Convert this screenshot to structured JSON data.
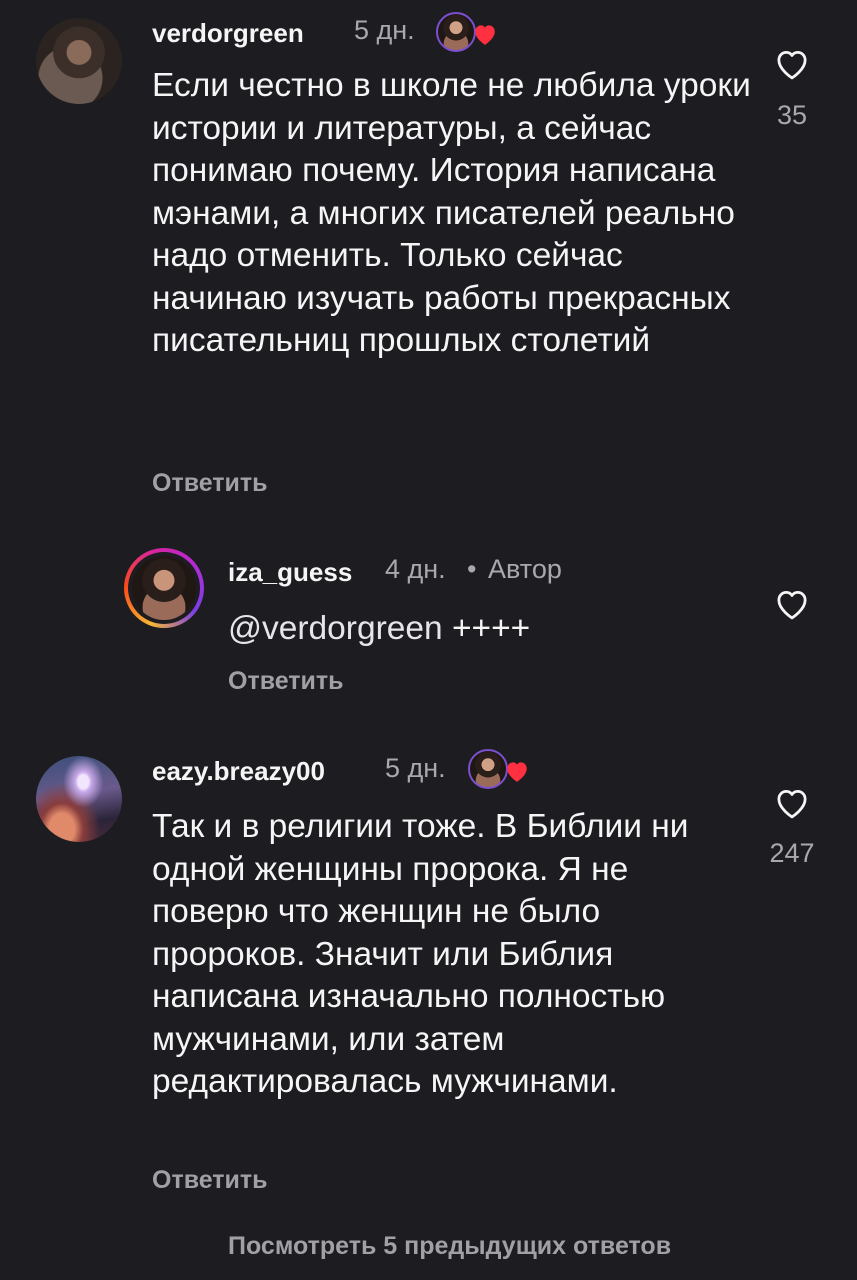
{
  "comments": [
    {
      "username": "verdorgreen",
      "age": "5 дн.",
      "text": "Если честно в школе не любила уроки истории и литературы, а сейчас понимаю почему. История написана мэнами, а многих писателей реально надо отменить. Только сейчас начинаю изучать работы прекрасных писательниц прошлых столетий",
      "reply_label": "Ответить",
      "likes": "35",
      "liked_by_author": true
    },
    {
      "username": "iza_guess",
      "age": "4 дн.",
      "author_separator": "•",
      "author_label": "Автор",
      "mention": "@verdorgreen",
      "text_suffix": " ++++",
      "reply_label": "Ответить"
    },
    {
      "username": "eazy.breazy00",
      "age": "5 дн.",
      "text": "Так и в религии тоже. В Библии ни одной женщины пророка. Я не поверю что женщин не было пророков. Значит или Библия написана изначально полностью мужчинами, или затем редактировалась мужчинами.",
      "reply_label": "Ответить",
      "likes": "247",
      "liked_by_author": true
    }
  ],
  "footer": {
    "view_replies_label": "Посмотреть 5 предыдущих ответов"
  },
  "colors": {
    "background": "#1c1c21",
    "primary_text": "#f5f5f5",
    "secondary_text": "#a8a8ad",
    "like_heart": "#ff3040"
  },
  "icons": [
    "heart-outline-icon",
    "heart-filled-icon",
    "author-avatar-icon"
  ]
}
